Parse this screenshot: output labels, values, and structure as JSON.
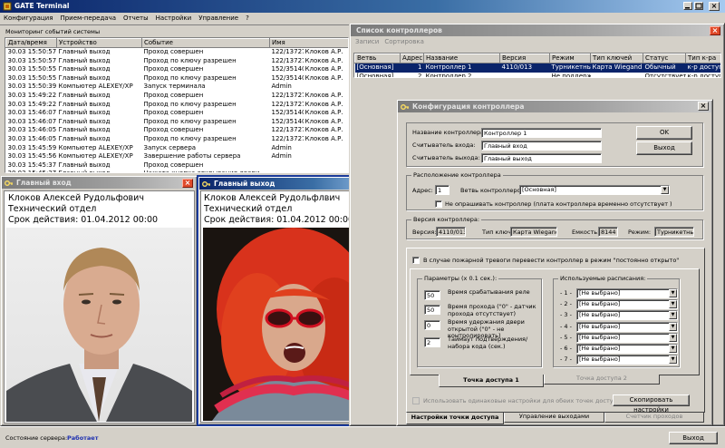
{
  "app": {
    "title": "GATE Terminal",
    "menu": [
      "Конфигурация",
      "Прием-передача",
      "Отчеты",
      "Настройки",
      "Управление",
      "?"
    ]
  },
  "monitor": {
    "title": "Мониторинг событий системы",
    "columns": [
      "Дата/время",
      "Устройство",
      "Событие",
      "Имя"
    ],
    "rows": [
      [
        "30.03  15:50:57",
        "Главный выход",
        "Проход совершен",
        "122/13727",
        "Клоков А.Р."
      ],
      [
        "30.03  15:50:57",
        "Главный выход",
        "Проход по ключу разрешен",
        "122/13727",
        "Клоков А.Р."
      ],
      [
        "30.03  15:50:55",
        "Главный выход",
        "Проход совершен",
        "152/35140",
        "Клоков А.Р."
      ],
      [
        "30.03  15:50:55",
        "Главный выход",
        "Проход по ключу разрешен",
        "152/35140",
        "Клоков А.Р."
      ],
      [
        "30.03  15:50:39",
        "Компьютер ALEXEY/XP",
        "Запуск терминала",
        "Admin",
        ""
      ],
      [
        "30.03  15:49:22",
        "Главный выход",
        "Проход совершен",
        "122/13727",
        "Клоков А.Р."
      ],
      [
        "30.03  15:49:22",
        "Главный выход",
        "Проход по ключу разрешен",
        "122/13727",
        "Клоков А.Р."
      ],
      [
        "30.03  15:46:07",
        "Главный выход",
        "Проход совершен",
        "152/35140",
        "Клоков А.Р."
      ],
      [
        "30.03  15:46:07",
        "Главный выход",
        "Проход по ключу разрешен",
        "152/35140",
        "Клоков А.Р."
      ],
      [
        "30.03  15:46:05",
        "Главный выход",
        "Проход совершен",
        "122/13727",
        "Клоков А.Р."
      ],
      [
        "30.03  15:46:05",
        "Главный выход",
        "Проход по ключу разрешен",
        "122/13727",
        "Клоков А.Р."
      ],
      [
        "30.03  15:45:59",
        "Компьютер ALEXEY/XP",
        "Запуск сервера",
        "Admin",
        ""
      ],
      [
        "30.03  15:45:56",
        "Компьютер ALEXEY/XP",
        "Завершение работы сервера",
        "Admin",
        ""
      ],
      [
        "30.03  15:45:37",
        "Главный выход",
        "Проход совершен",
        "",
        ""
      ],
      [
        "30.03  15:45:37",
        "Главный выход",
        "Нажата кнопка открывания двери",
        "",
        ""
      ]
    ]
  },
  "status": {
    "label": "Состояние сервера:",
    "value": "Работает",
    "exit": "Выход"
  },
  "popup1": {
    "title": "Главный вход",
    "name": "Клоков Алексей Рудольфович",
    "dept": "Технический отдел",
    "validity": "Срок действия: 01.04.2012 00:00"
  },
  "popup2": {
    "title": "Главный выход",
    "name": "Клоков Алексей Рудольфлвич",
    "dept": "Технический отдел",
    "validity": "Срок действия: 01.04.2012 00:00"
  },
  "controllers": {
    "title": "Список контроллеров",
    "menu": [
      "Записи",
      "Сортировка"
    ],
    "columns": [
      "Ветвь",
      "Адрес",
      "Название",
      "Версия",
      "Режим",
      "Тип ключей",
      "Статус",
      "Тип к-ра"
    ],
    "rows": [
      [
        "[Основная]",
        "1",
        "Контроллер 1",
        "4110/013",
        "Турникетный",
        "Карта Wiegand",
        "Обычный",
        "к-р доступа"
      ],
      [
        "[Основная]",
        "2",
        "Контроллер 2",
        "",
        "Не поддерж.",
        "",
        "Отсутствует",
        "к-р доступа"
      ]
    ]
  },
  "config": {
    "title": "Конфигурация контроллера",
    "name_label": "Название контроллера:",
    "name_value": "Контроллер 1",
    "reader_in_label": "Считыватель входа:",
    "reader_in_value": "Главный вход",
    "reader_out_label": "Считыватель выхода:",
    "reader_out_value": "Главный выход",
    "ok": "OK",
    "exit": "Выход",
    "location_title": "Расположение контроллера",
    "address_label": "Адрес:",
    "address_value": "1",
    "branch_label": "Ветвь контроллеров:",
    "branch_value": "[Основная]",
    "no_poll_label": "Не опрашивать контроллер  (плата контроллера временно отсутствует )",
    "version_title": "Версия контроллера:",
    "version_label": "Версия:",
    "version_value": "4110/013",
    "keytype_label": "Тип ключей:",
    "keytype_value": "Карта Wiegand",
    "capacity_label": "Емкость:",
    "capacity_value": "8144",
    "mode_label": "Режим:",
    "mode_value": "Турникетный",
    "fire_label": "В случае пожарной тревоги перевести контроллер в режим \"постоянно открыто\"",
    "params_title": "Параметры (х 0.1 сек.):",
    "params": [
      {
        "value": "50",
        "label": "Время срабатывания реле"
      },
      {
        "value": "50",
        "label": "Время прохода (\"0\" - датчик прохода отсутствует)"
      },
      {
        "value": "0",
        "label": "Время удержания двери открытой (\"0\" - не контролировать)"
      },
      {
        "value": "2",
        "label": "Таймаут подтверждения/ набора кода (сек.)"
      }
    ],
    "schedules_title": "Используемые расписания:",
    "schedules": [
      {
        "num": "- 1 -",
        "value": "[Не выбрано]"
      },
      {
        "num": "- 2 -",
        "value": "[Не выбрано]"
      },
      {
        "num": "- 3 -",
        "value": "[Не выбрано]"
      },
      {
        "num": "- 4 -",
        "value": "[Не выбрано]"
      },
      {
        "num": "- 5 -",
        "value": "[Не выбрано]"
      },
      {
        "num": "- 6 -",
        "value": "[Не выбрано]"
      },
      {
        "num": "- 7 -",
        "value": "[Не выбрано]"
      }
    ],
    "inner_tabs": [
      "Точка доступа 1",
      "Точка доступа 2"
    ],
    "same_settings_label": "Использовать одинаковые настройки для обеих точек доступа",
    "copy_button": "Скопировать настройки",
    "outer_tabs": [
      "Настройки точки доступа",
      "Управление выходами",
      "Счетчик проходов"
    ]
  }
}
